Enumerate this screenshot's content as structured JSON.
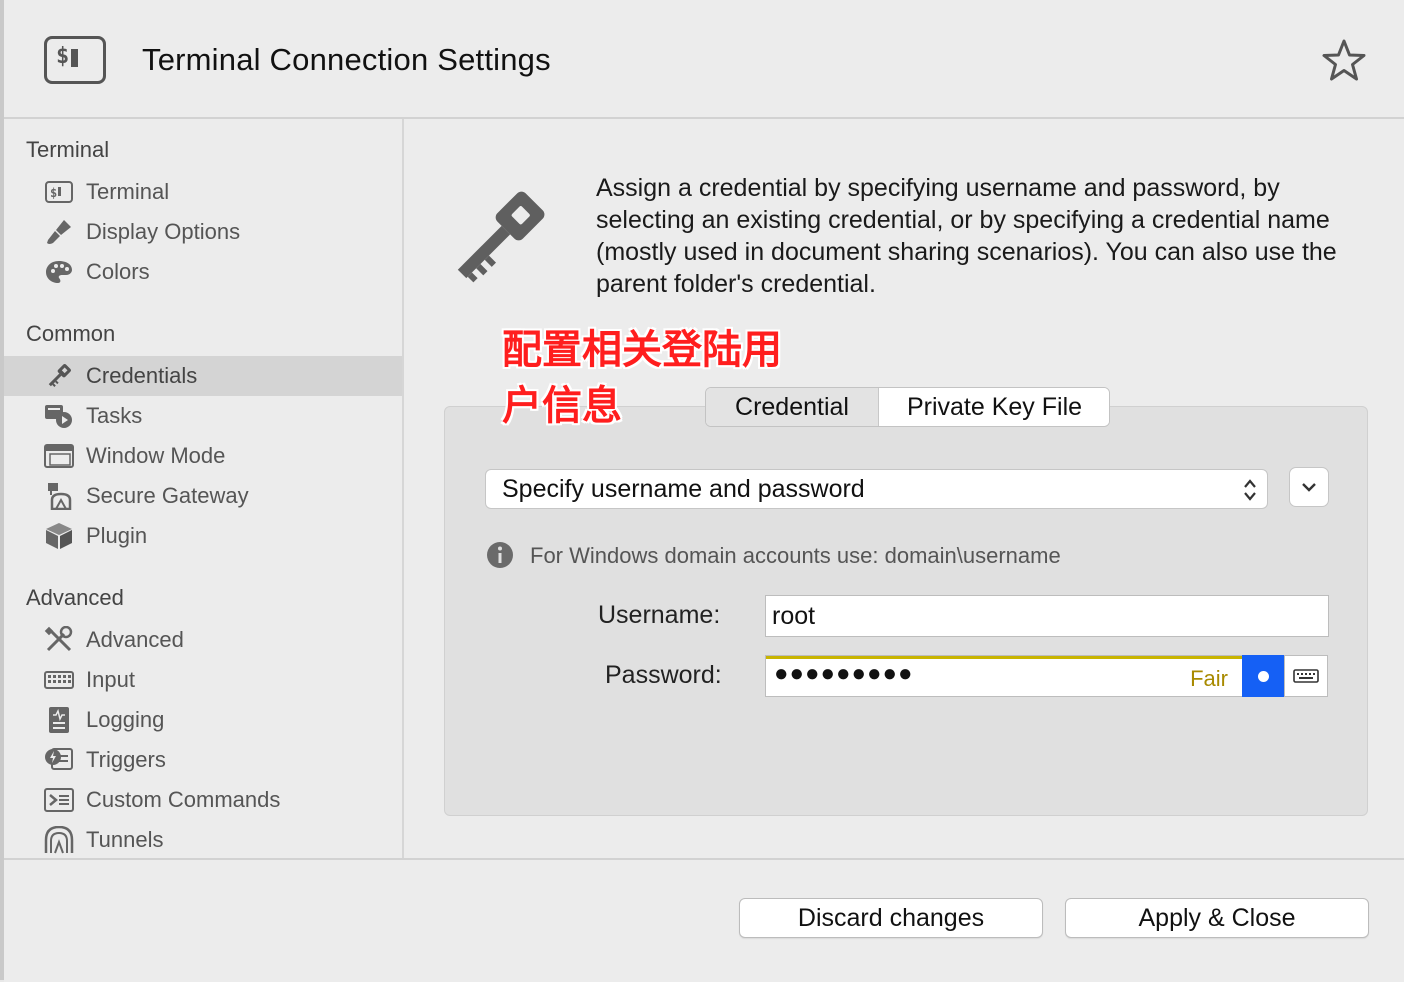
{
  "header": {
    "title": "Terminal Connection Settings",
    "icon": "terminal-icon",
    "favorite_icon": "star-icon"
  },
  "sidebar": {
    "groups": [
      {
        "title": "Terminal",
        "items": [
          {
            "label": "Terminal",
            "icon": "terminal-icon"
          },
          {
            "label": "Display Options",
            "icon": "brush-icon"
          },
          {
            "label": "Colors",
            "icon": "palette-icon"
          }
        ]
      },
      {
        "title": "Common",
        "items": [
          {
            "label": "Credentials",
            "icon": "key-icon",
            "selected": true
          },
          {
            "label": "Tasks",
            "icon": "tasks-icon"
          },
          {
            "label": "Window Mode",
            "icon": "window-icon"
          },
          {
            "label": "Secure Gateway",
            "icon": "gateway-icon"
          },
          {
            "label": "Plugin",
            "icon": "cube-icon"
          }
        ]
      },
      {
        "title": "Advanced",
        "items": [
          {
            "label": "Advanced",
            "icon": "tools-icon"
          },
          {
            "label": "Input",
            "icon": "keyboard-icon"
          },
          {
            "label": "Logging",
            "icon": "log-icon"
          },
          {
            "label": "Triggers",
            "icon": "trigger-icon"
          },
          {
            "label": "Custom Commands",
            "icon": "commands-icon"
          },
          {
            "label": "Tunnels",
            "icon": "tunnel-icon"
          }
        ]
      }
    ]
  },
  "main": {
    "description": "Assign a credential by specifying username and password, by selecting an existing credential, or by specifying a credential name (mostly used in document sharing scenarios). You can also use the parent folder's credential.",
    "annotation": "配置相关登陆用户信息",
    "tabs": [
      {
        "label": "Credential",
        "selected": true
      },
      {
        "label": "Private Key File",
        "selected": false
      }
    ],
    "credential_mode": "Specify username and password",
    "info_text": "For Windows domain accounts use: domain\\username",
    "username_label": "Username:",
    "username_value": "root",
    "password_label": "Password:",
    "password_masked": "●●●●●●●●●",
    "password_strength": "Fair",
    "colors": {
      "accent": "#1560f5",
      "strength": "#c8b400",
      "annotation": "#ff1e1e"
    }
  },
  "footer": {
    "discard_label": "Discard changes",
    "apply_label": "Apply & Close"
  }
}
